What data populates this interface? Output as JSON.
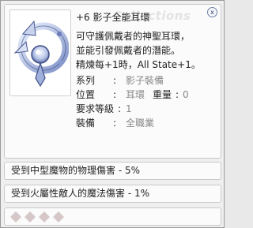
{
  "item": {
    "title": "+6 影子全能耳環",
    "watermark": "Collections",
    "close_glyph": "x",
    "description": [
      "可守護佩戴者的神聖耳環，",
      "並能引發佩戴者的潛能。",
      "精煉每+1時，All State+1。"
    ],
    "stats": {
      "type_label": "系列",
      "type_value": "影子裝備",
      "position_label": "位置",
      "position_value": "耳環",
      "weight_label": "重量",
      "weight_value": "0",
      "level_label": "要求等級",
      "level_value": "1",
      "equip_label": "裝備",
      "equip_value": "全職業",
      "separator": ":"
    }
  },
  "effects": [
    "受到中型魔物的物理傷害 - 5%",
    "受到火屬性敵人的魔法傷害 - 1%"
  ],
  "slots": {
    "count": 4,
    "color": "#d6c8c8"
  },
  "icons": {
    "item_image": "earring-icon",
    "close": "close-icon",
    "slot": "card-slot-icon"
  }
}
